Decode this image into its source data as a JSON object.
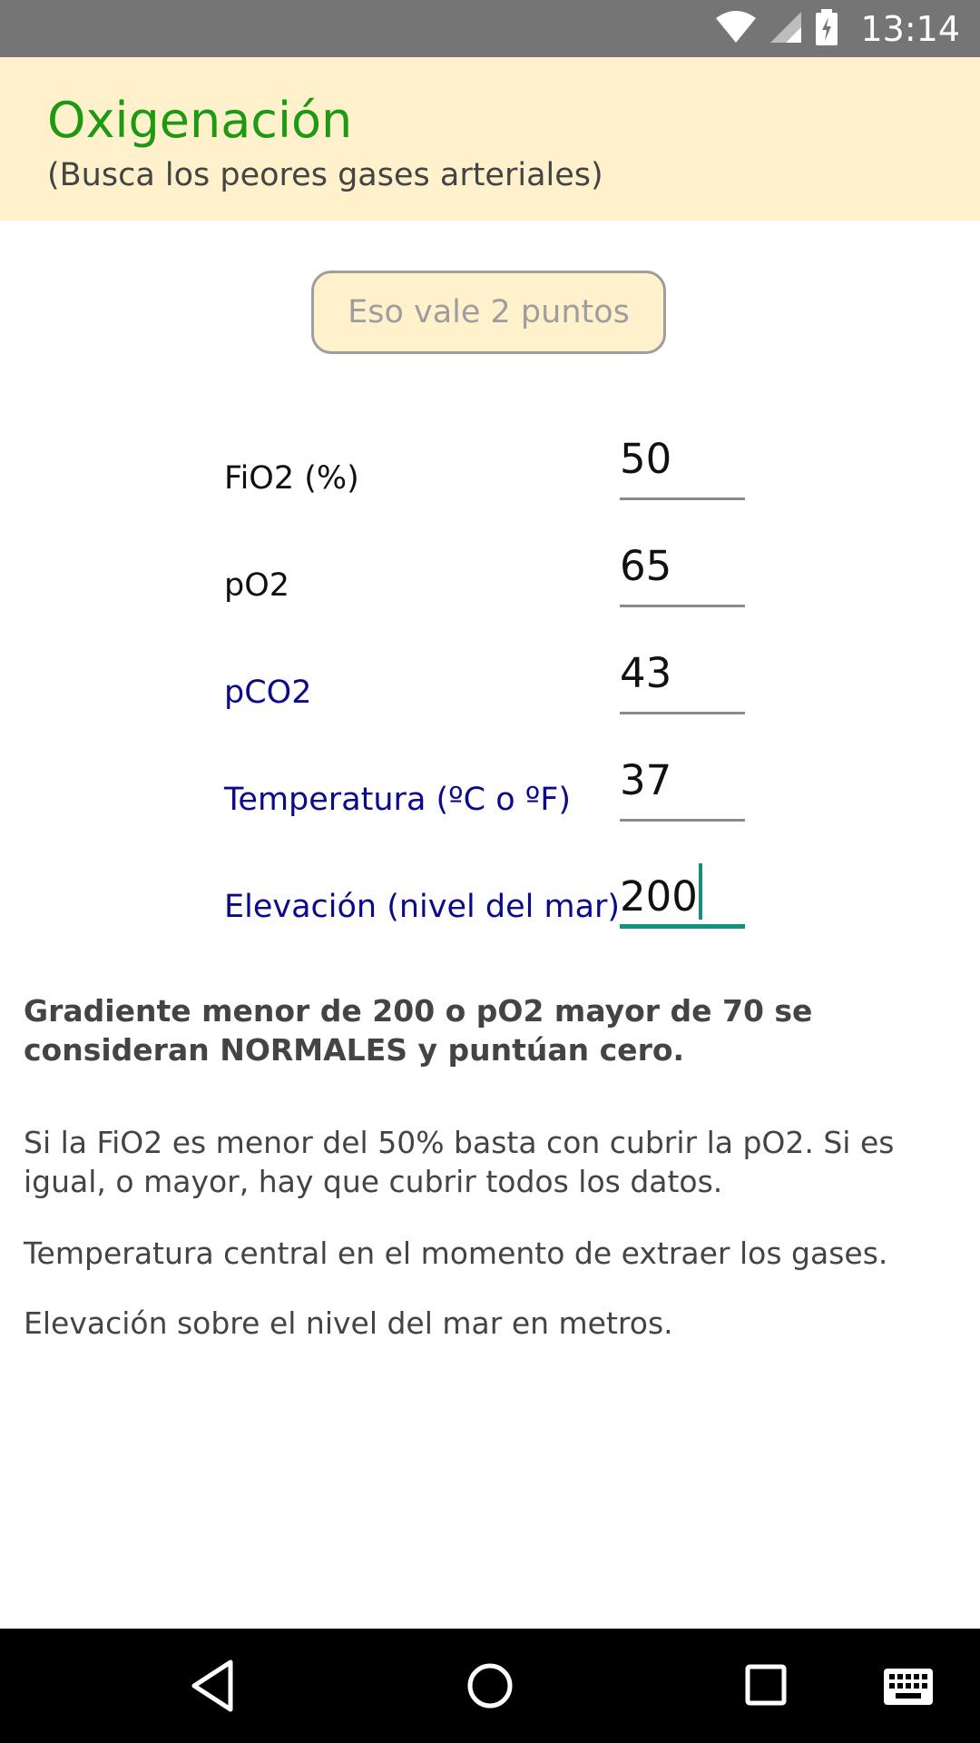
{
  "status_bar": {
    "time": "13:14"
  },
  "header": {
    "title": "Oxigenación",
    "subtitle": "(Busca los peores gases arteriales)"
  },
  "score_button": {
    "label": "Eso vale 2 puntos"
  },
  "fields": [
    {
      "label": "FiO2 (%)",
      "value": "50"
    },
    {
      "label": "pO2",
      "value": "65"
    },
    {
      "label": "pCO2",
      "value": "43"
    },
    {
      "label": "Temperatura (ºC o ºF)",
      "value": "37"
    },
    {
      "label": "Elevación (nivel del mar)",
      "value": "200"
    }
  ],
  "notes": {
    "bold": "Gradiente menor de 200 o pO2 mayor de 70 se consideran NORMALES y puntúan cero.",
    "p1": "Si la FiO2 es menor del 50% basta con cubrir la pO2. Si es igual, o mayor, hay que cubrir todos los datos.",
    "p2": "Temperatura central en el momento de extraer los gases.",
    "p3": "Elevación sobre el nivel del mar en metros."
  },
  "colors": {
    "header_bg": "#fff1cc",
    "title": "#1e9a12",
    "blue_label": "#0a0a8a",
    "accent": "#15907e"
  },
  "icons": [
    "wifi-icon",
    "signal-icon",
    "battery-icon",
    "back-icon",
    "home-icon",
    "recents-icon",
    "keyboard-icon"
  ]
}
